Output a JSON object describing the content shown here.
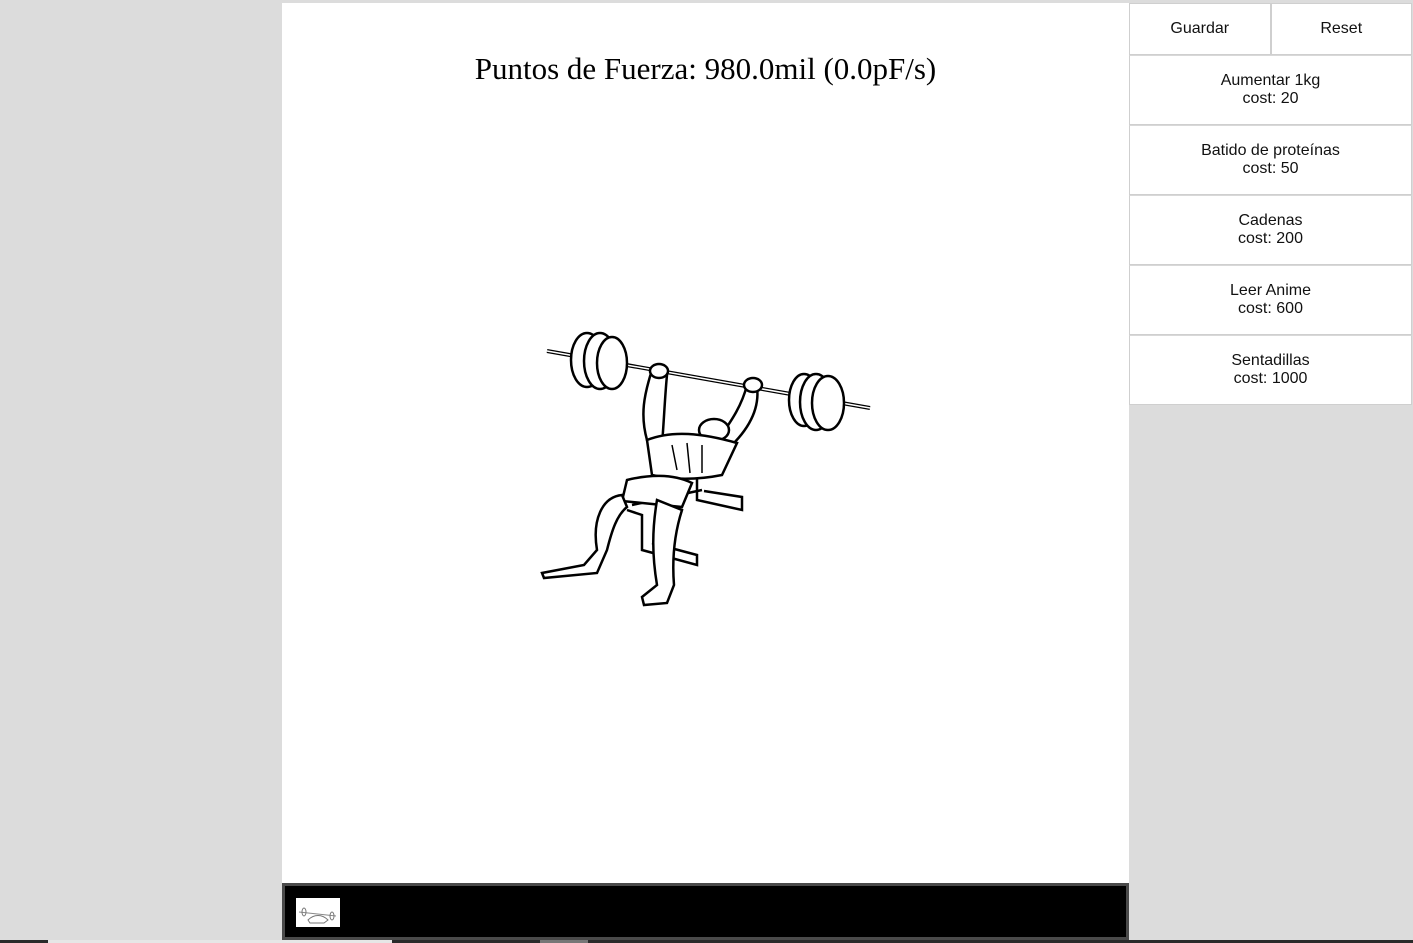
{
  "game": {
    "score_text": "Puntos de Fuerza: 980.0mil (0.0pF/s)"
  },
  "controls": {
    "save_label": "Guardar",
    "reset_label": "Reset"
  },
  "upgrades": [
    {
      "name": "Aumentar 1kg",
      "cost": "cost: 20"
    },
    {
      "name": "Batido de proteínas",
      "cost": "cost: 50"
    },
    {
      "name": "Cadenas",
      "cost": "cost: 200"
    },
    {
      "name": "Leer Anime",
      "cost": "cost: 600"
    },
    {
      "name": "Sentadillas",
      "cost": "cost: 1000"
    }
  ],
  "icons": {
    "hero": "bench-press-illustration",
    "thumb": "bench-press-thumbnail"
  },
  "colors": {
    "background": "#dcdcdc",
    "panel": "#ffffff",
    "bottom_bar": "#000000"
  }
}
